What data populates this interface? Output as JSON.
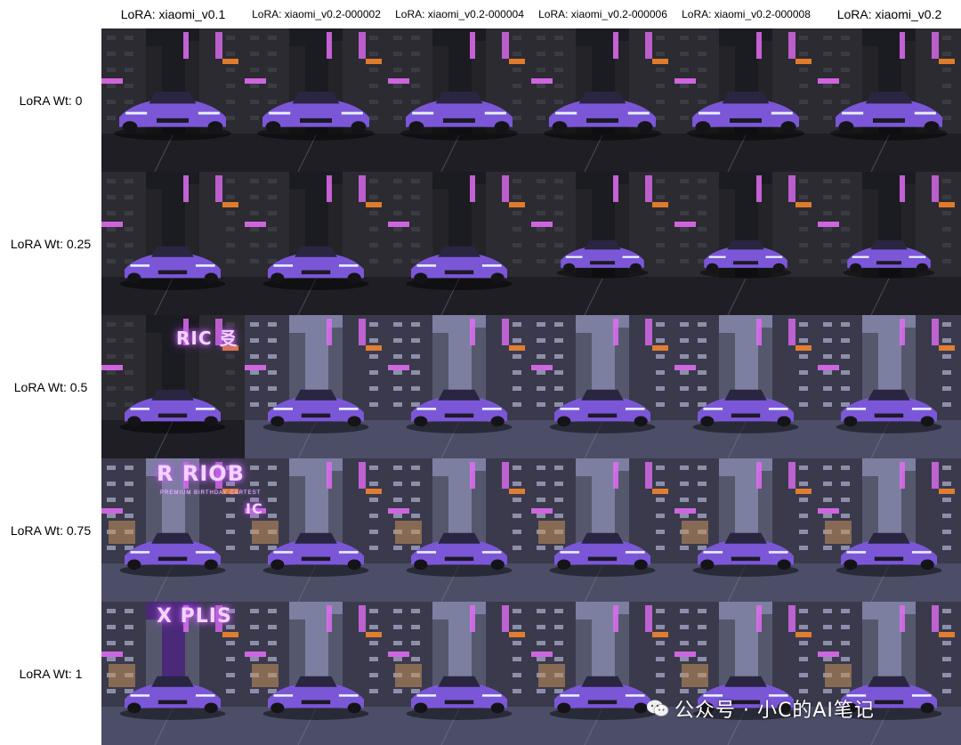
{
  "columns": [
    "LoRA: xiaomi_v0.1",
    "LoRA: xiaomi_v0.2-000002",
    "LoRA: xiaomi_v0.2-000004",
    "LoRA: xiaomi_v0.2-000006",
    "LoRA: xiaomi_v0.2-000008",
    "LoRA: xiaomi_v0.2"
  ],
  "rows": [
    "LoRA Wt: 0",
    "LoRA Wt: 0.25",
    "LoRA Wt: 0.5",
    "LoRA Wt: 0.75",
    "LoRA Wt: 1"
  ],
  "signs": {
    "row3_sign": "RIC 㕛",
    "row4_sign": "R RIOB",
    "row4_subtext": "PREMIUM   BIRTHDAY   CARTEST",
    "row4_side": "IC",
    "row5_sign": "X PLIS"
  },
  "watermark": "公众号 · 小C的AI笔记",
  "colors": {
    "car_purple": "#7b57d8",
    "neon_pink": "#e06cf2",
    "night_street": "#2a2a33",
    "day_street": "#6f7490"
  }
}
